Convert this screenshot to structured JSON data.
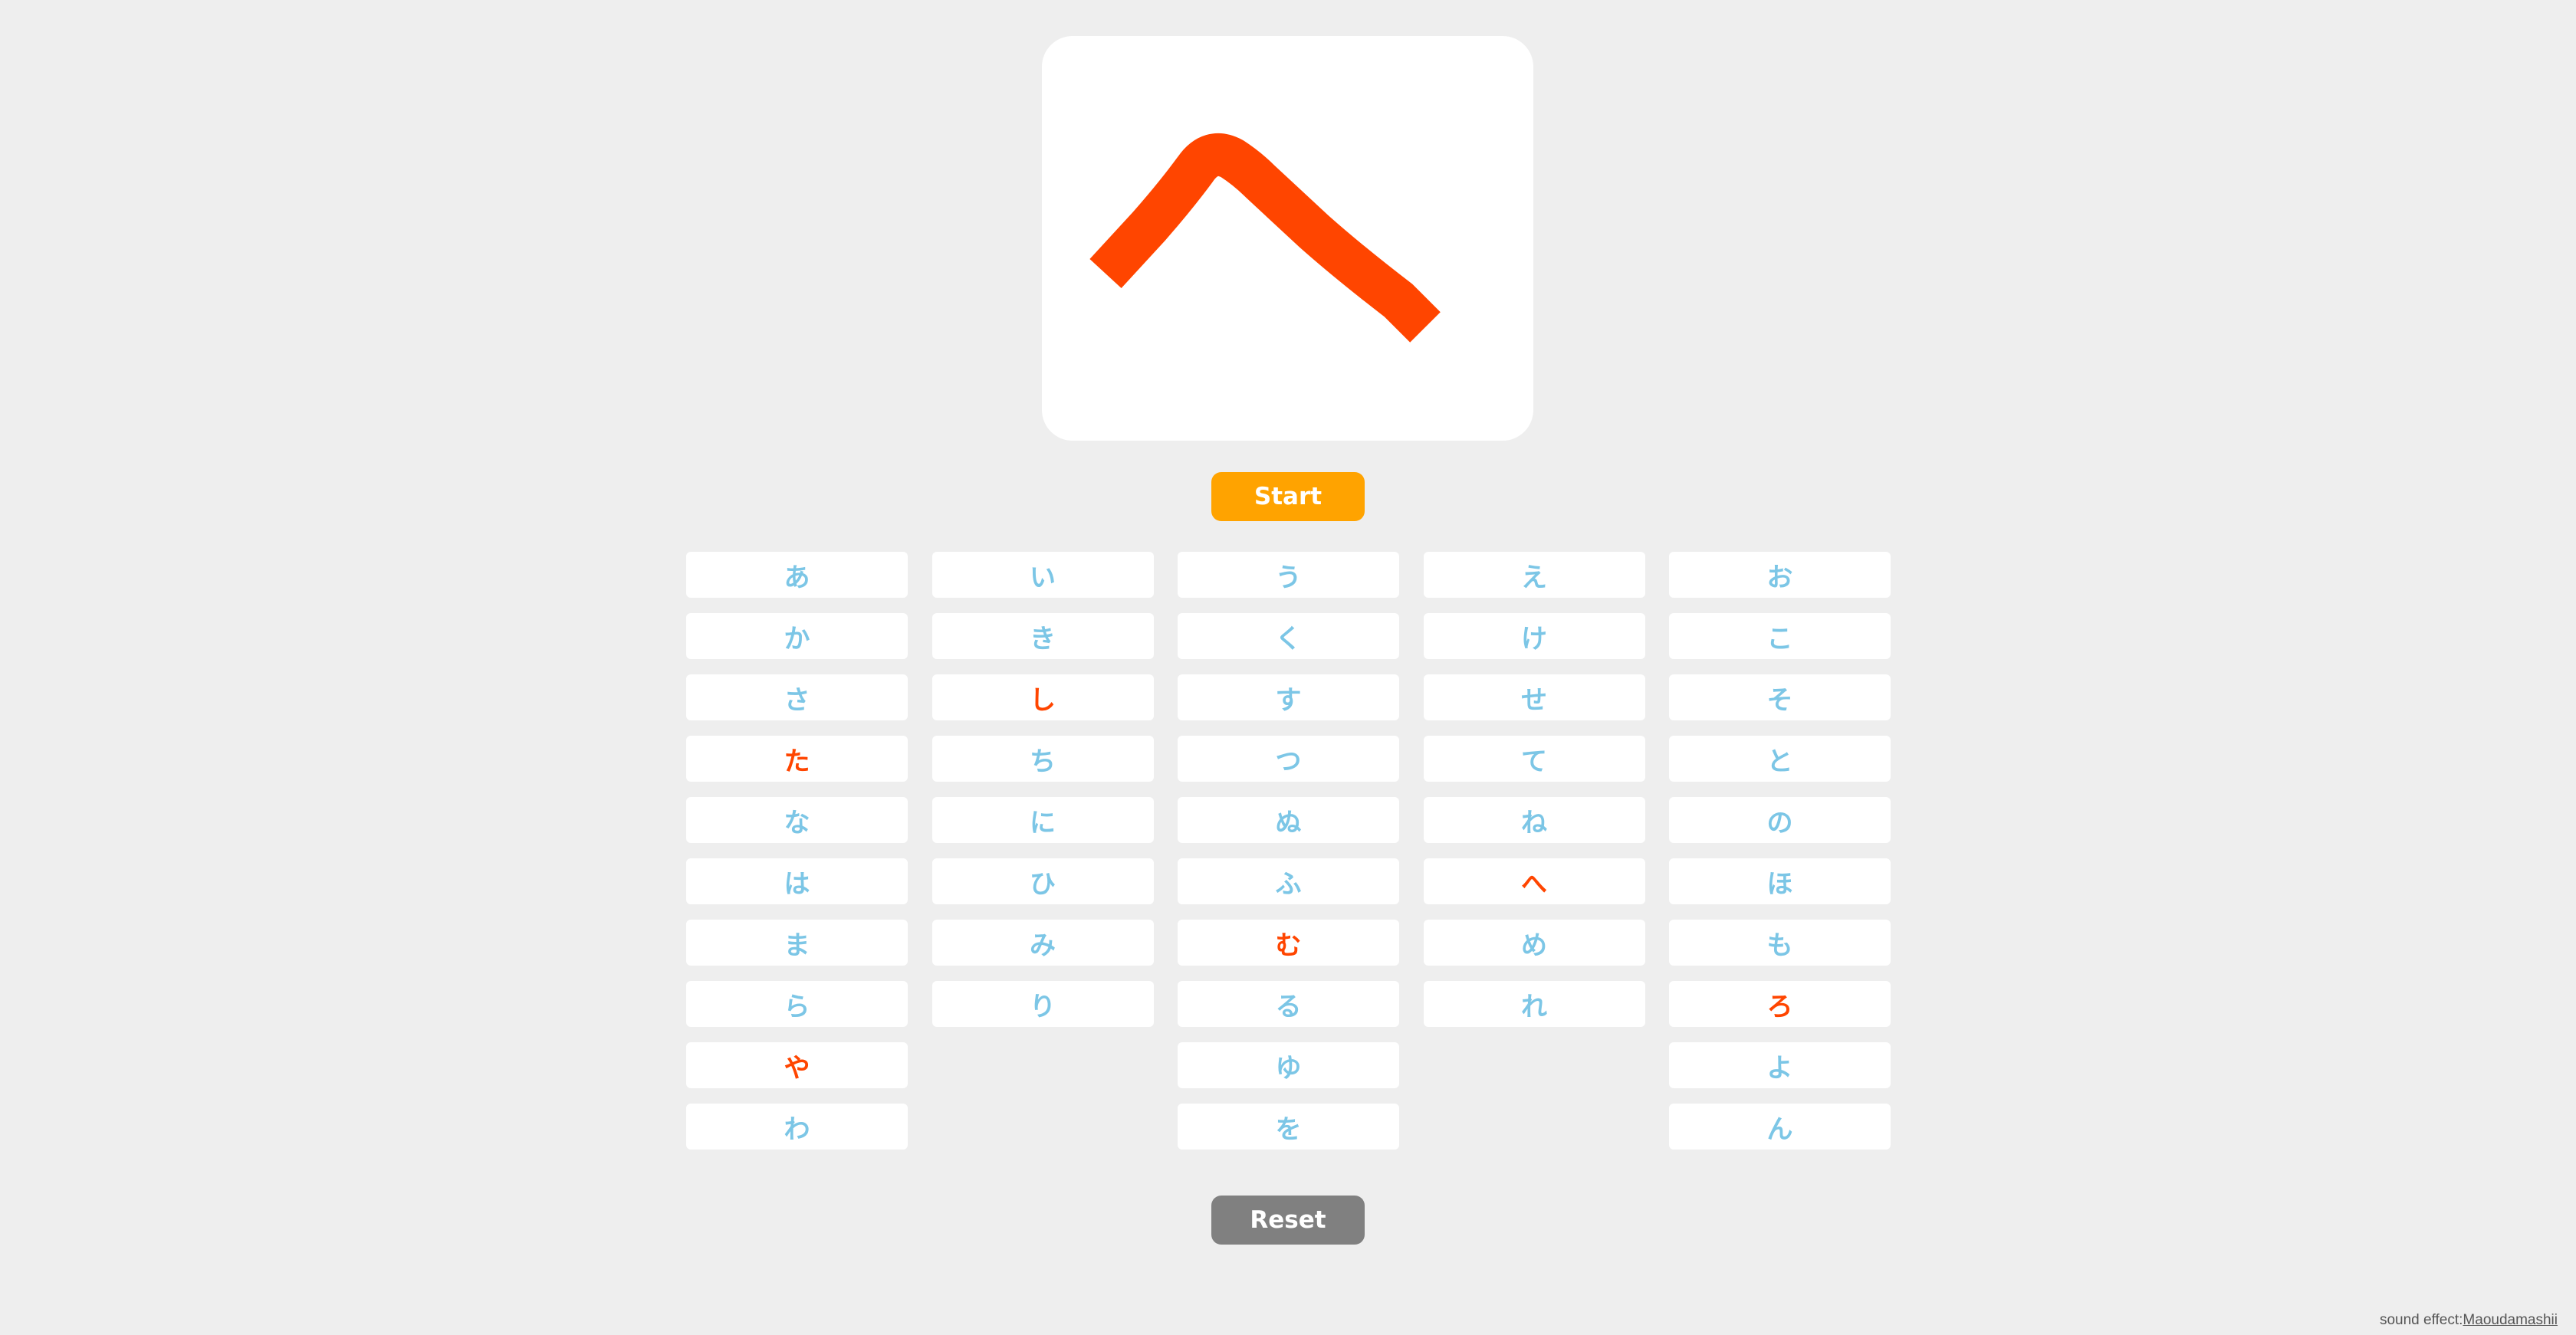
{
  "display": {
    "current_character": "へ",
    "stroke_color": "#ff4500"
  },
  "start_button": {
    "label": "Start",
    "color": "#ffa300"
  },
  "reset_button": {
    "label": "Reset",
    "color": "#808080"
  },
  "kana_grid": {
    "default_color": "#7cc6e6",
    "active_color": "#ff4500",
    "rows": [
      [
        {
          "char": "あ",
          "active": false
        },
        {
          "char": "い",
          "active": false
        },
        {
          "char": "う",
          "active": false
        },
        {
          "char": "え",
          "active": false
        },
        {
          "char": "お",
          "active": false
        }
      ],
      [
        {
          "char": "か",
          "active": false
        },
        {
          "char": "き",
          "active": false
        },
        {
          "char": "く",
          "active": false
        },
        {
          "char": "け",
          "active": false
        },
        {
          "char": "こ",
          "active": false
        }
      ],
      [
        {
          "char": "さ",
          "active": false
        },
        {
          "char": "し",
          "active": true
        },
        {
          "char": "す",
          "active": false
        },
        {
          "char": "せ",
          "active": false
        },
        {
          "char": "そ",
          "active": false
        }
      ],
      [
        {
          "char": "た",
          "active": true
        },
        {
          "char": "ち",
          "active": false
        },
        {
          "char": "つ",
          "active": false
        },
        {
          "char": "て",
          "active": false
        },
        {
          "char": "と",
          "active": false
        }
      ],
      [
        {
          "char": "な",
          "active": false
        },
        {
          "char": "に",
          "active": false
        },
        {
          "char": "ぬ",
          "active": false
        },
        {
          "char": "ね",
          "active": false
        },
        {
          "char": "の",
          "active": false
        }
      ],
      [
        {
          "char": "は",
          "active": false
        },
        {
          "char": "ひ",
          "active": false
        },
        {
          "char": "ふ",
          "active": false
        },
        {
          "char": "へ",
          "active": true
        },
        {
          "char": "ほ",
          "active": false
        }
      ],
      [
        {
          "char": "ま",
          "active": false
        },
        {
          "char": "み",
          "active": false
        },
        {
          "char": "む",
          "active": true
        },
        {
          "char": "め",
          "active": false
        },
        {
          "char": "も",
          "active": false
        }
      ],
      [
        {
          "char": "ら",
          "active": false
        },
        {
          "char": "り",
          "active": false
        },
        {
          "char": "る",
          "active": false
        },
        {
          "char": "れ",
          "active": false
        },
        {
          "char": "ろ",
          "active": true
        }
      ],
      [
        {
          "char": "や",
          "active": true
        },
        null,
        {
          "char": "ゆ",
          "active": false
        },
        null,
        {
          "char": "よ",
          "active": false
        }
      ],
      [
        {
          "char": "わ",
          "active": false
        },
        null,
        {
          "char": "を",
          "active": false
        },
        null,
        {
          "char": "ん",
          "active": false
        }
      ]
    ]
  },
  "credit": {
    "prefix": "sound effect:",
    "link_text": "Maoudamashii"
  }
}
